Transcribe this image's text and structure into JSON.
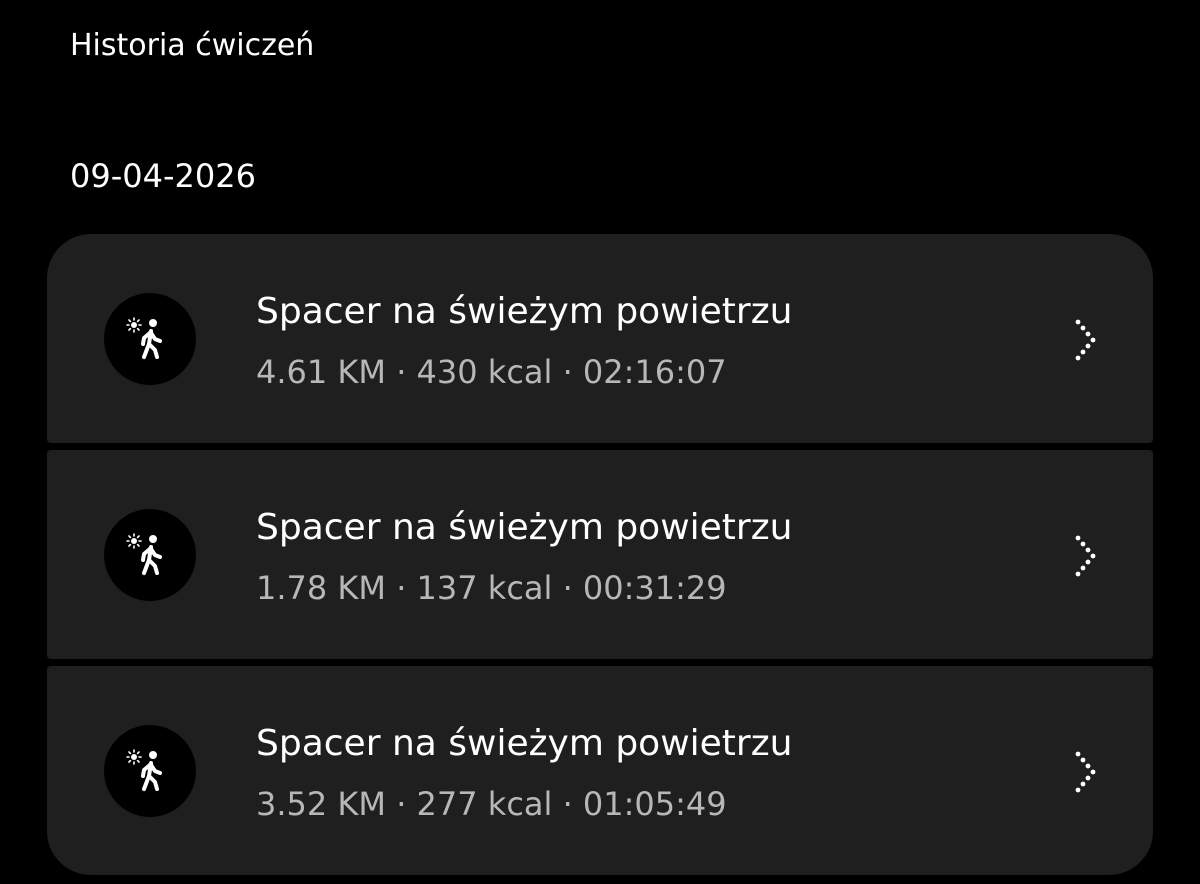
{
  "header": {
    "title": "Historia ćwiczeń"
  },
  "date_group": "09-04-2026",
  "workouts": [
    {
      "title": "Spacer na świeżym powietrzu",
      "stats": "4.61 KM · 430 kcal · 02:16:07",
      "icon": "outdoor-walk-icon"
    },
    {
      "title": "Spacer na świeżym powietrzu",
      "stats": "1.78 KM · 137 kcal · 00:31:29",
      "icon": "outdoor-walk-icon"
    },
    {
      "title": "Spacer na świeżym powietrzu",
      "stats": "3.52 KM · 277 kcal · 01:05:49",
      "icon": "outdoor-walk-icon"
    }
  ],
  "colors": {
    "background": "#000000",
    "card": "#1f1f1f",
    "primary_text": "#ffffff",
    "secondary_text": "#b7b7b7"
  }
}
